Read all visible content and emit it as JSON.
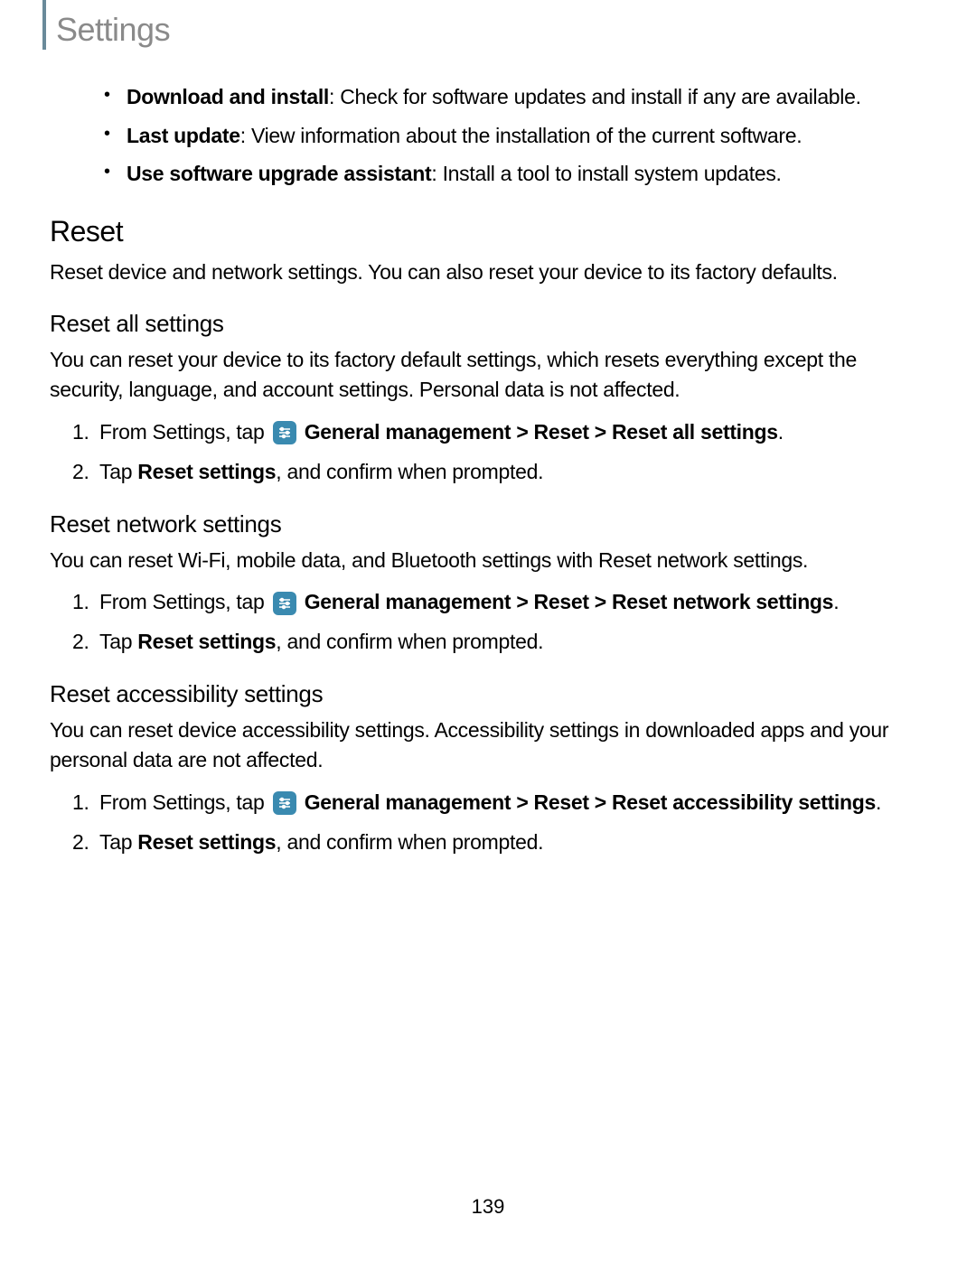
{
  "header": {
    "title": "Settings"
  },
  "bullets": {
    "item1_bold": "Download and install",
    "item1_text": ": Check for software updates and install if any are available.",
    "item2_bold": "Last update",
    "item2_text": ": View information about the installation of the current software.",
    "item3_bold": "Use software upgrade assistant",
    "item3_text": ": Install a tool to install system updates."
  },
  "section1": {
    "heading": "Reset",
    "body": "Reset device and network settings. You can also reset your device to its factory defaults."
  },
  "section2": {
    "heading": "Reset all settings",
    "body": "You can reset your device to its factory default settings, which resets everything except the security, language, and account settings. Personal data is not affected.",
    "step1_pre": "From Settings, tap ",
    "step1_bold": "General management > Reset > Reset all settings",
    "step1_post": ".",
    "step2_pre": "Tap ",
    "step2_bold": "Reset settings",
    "step2_post": ", and confirm when prompted."
  },
  "section3": {
    "heading": "Reset network settings",
    "body": "You can reset Wi-Fi, mobile data, and Bluetooth settings with Reset network settings.",
    "step1_pre": "From Settings, tap ",
    "step1_bold": "General management > Reset > Reset network settings",
    "step1_post": ".",
    "step2_pre": "Tap ",
    "step2_bold": "Reset settings",
    "step2_post": ", and confirm when prompted."
  },
  "section4": {
    "heading": "Reset accessibility settings",
    "body": "You can reset device accessibility settings. Accessibility settings in downloaded apps and your personal data are not affected.",
    "step1_pre": "From Settings, tap ",
    "step1_bold": "General management > Reset > Reset accessibility settings",
    "step1_post": ".",
    "step2_pre": "Tap ",
    "step2_bold": "Reset settings",
    "step2_post": ", and confirm when prompted."
  },
  "page_number": "139"
}
